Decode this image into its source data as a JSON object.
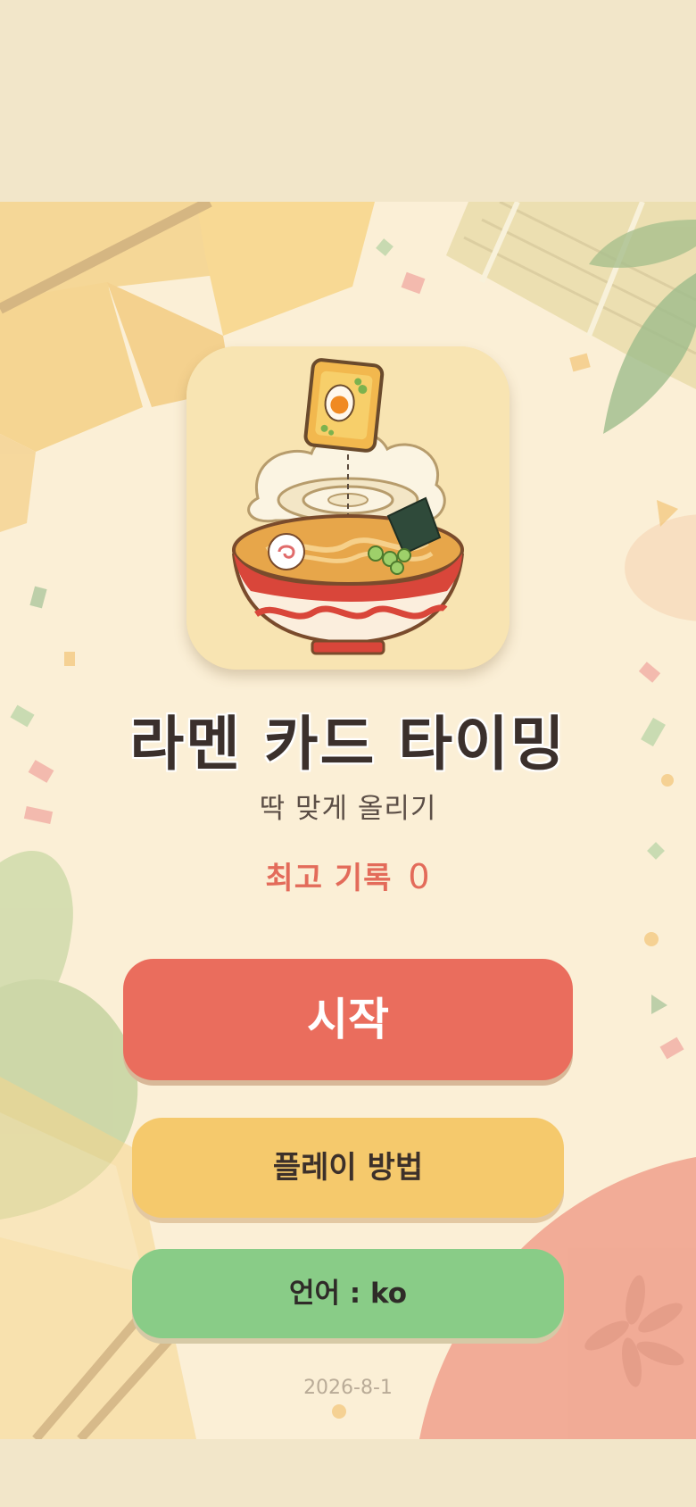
{
  "game": {
    "title": "라멘 카드 타이밍",
    "subtitle": "딱 맞게 올리기",
    "best_label": "최고 기록",
    "best_score": "0",
    "start_button": "시작",
    "howto_button": "플레이 방법",
    "language_button": "언어 : ko",
    "date": "2026-8-1"
  },
  "colors": {
    "background": "#fbefd6",
    "start": "#ea6d5d",
    "howto": "#f5c96c",
    "language": "#89cc87",
    "accent": "#e36b5a"
  },
  "icons": {
    "logo": "ramen-bowl-card-icon"
  }
}
